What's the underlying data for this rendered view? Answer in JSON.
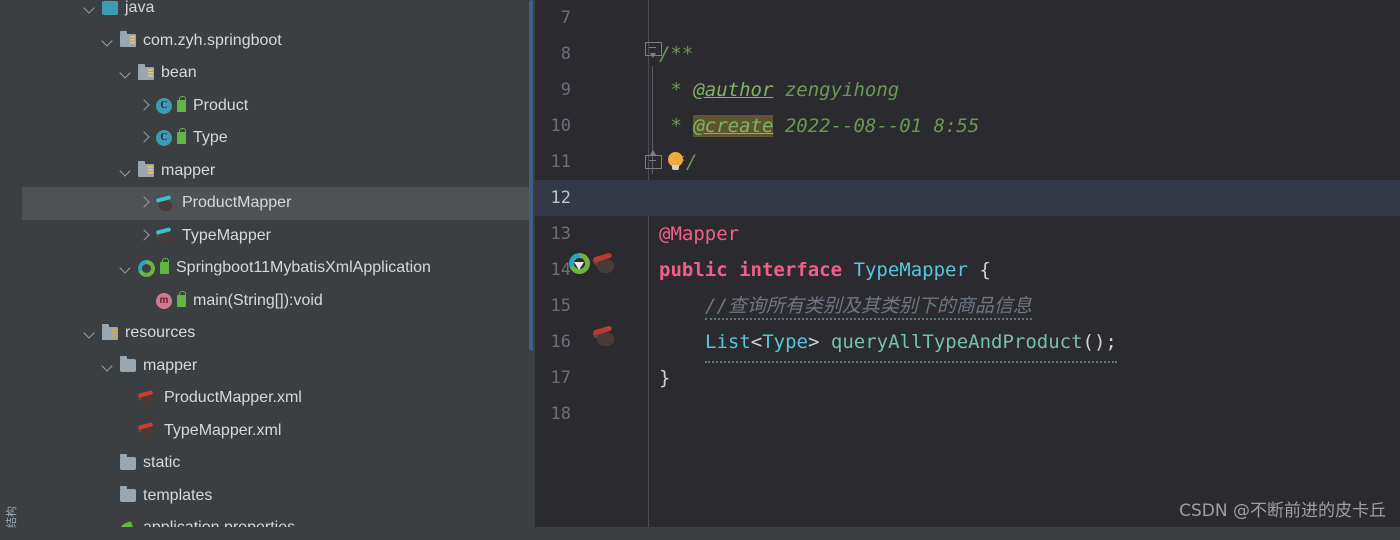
{
  "app": {
    "theme_bg": "#3c3f41",
    "editor_bg": "#2b2b2f",
    "selection_color": "#4e5254",
    "caret_line_color": "#323846",
    "scrollbar_color": "#3d6185"
  },
  "toolwindow": {
    "vertical_tab_label": "结构"
  },
  "project_tree": {
    "items": [
      {
        "label": "java",
        "icon": "java-source-folder-icon",
        "indent": 3,
        "chevron": "down",
        "selected": false,
        "cutoff": true
      },
      {
        "label": "com.zyh.springboot",
        "icon": "package-folder-icon",
        "indent": 4,
        "chevron": "down",
        "selected": false
      },
      {
        "label": "bean",
        "icon": "package-folder-icon",
        "indent": 5,
        "chevron": "down",
        "selected": false
      },
      {
        "label": "Product",
        "icon": "java-class-icon",
        "indent": 6,
        "chevron": "right",
        "selected": false,
        "badge": "public-lock-icon"
      },
      {
        "label": "Type",
        "icon": "java-class-icon",
        "indent": 6,
        "chevron": "right",
        "selected": false,
        "badge": "public-lock-icon"
      },
      {
        "label": "mapper",
        "icon": "package-folder-icon",
        "indent": 5,
        "chevron": "down",
        "selected": false
      },
      {
        "label": "ProductMapper",
        "icon": "mybatis-mapper-icon",
        "indent": 6,
        "chevron": "right",
        "selected": true
      },
      {
        "label": "TypeMapper",
        "icon": "mybatis-mapper-icon",
        "indent": 6,
        "chevron": "right",
        "selected": false
      },
      {
        "label": "Springboot11MybatisXmlApplication",
        "icon": "spring-boot-class-icon",
        "indent": 5,
        "chevron": "down",
        "selected": false,
        "badge": "public-lock-icon"
      },
      {
        "label": "main(String[]):void",
        "icon": "java-method-icon",
        "indent": 6,
        "chevron": "none",
        "selected": false,
        "badge": "public-lock-icon"
      },
      {
        "label": "resources",
        "icon": "resources-folder-icon",
        "indent": 3,
        "chevron": "down",
        "selected": false
      },
      {
        "label": "mapper",
        "icon": "folder-icon",
        "indent": 4,
        "chevron": "down",
        "selected": false
      },
      {
        "label": "ProductMapper.xml",
        "icon": "mybatis-xml-icon",
        "indent": 5,
        "chevron": "none",
        "selected": false
      },
      {
        "label": "TypeMapper.xml",
        "icon": "mybatis-xml-icon",
        "indent": 5,
        "chevron": "none",
        "selected": false
      },
      {
        "label": "static",
        "icon": "folder-icon",
        "indent": 4,
        "chevron": "none",
        "selected": false
      },
      {
        "label": "templates",
        "icon": "folder-icon",
        "indent": 4,
        "chevron": "none",
        "selected": false
      },
      {
        "label": "application.properties",
        "icon": "spring-properties-icon",
        "indent": 4,
        "chevron": "none",
        "selected": false,
        "cutoff": true
      }
    ]
  },
  "editor": {
    "filename": "TypeMapper",
    "caret_line": 12,
    "lines": [
      {
        "num": "7",
        "text": ""
      },
      {
        "num": "8",
        "text": "/**"
      },
      {
        "num": "9",
        "text": " * @author zengyihong"
      },
      {
        "num": "10",
        "text": " * @create 2022--08--01 8:55"
      },
      {
        "num": "11",
        "text": " */"
      },
      {
        "num": "12",
        "text": ""
      },
      {
        "num": "13",
        "text": "@Mapper"
      },
      {
        "num": "14",
        "text": "public interface TypeMapper {"
      },
      {
        "num": "15",
        "text": "    //查询所有类别及其类别下的商品信息"
      },
      {
        "num": "16",
        "text": "    List<Type> queryAllTypeAndProduct();"
      },
      {
        "num": "17",
        "text": "}"
      },
      {
        "num": "18",
        "text": ""
      }
    ],
    "tokens": {
      "doc_open": "/**",
      "doc_star": " * ",
      "tag_author": "@author",
      "author_value": " zengyihong",
      "tag_create": "@create",
      "create_value": " 2022--08--01 8:55",
      "doc_close": " */",
      "annotation_mapper": "@Mapper",
      "kw_public": "public",
      "kw_interface": "interface",
      "type_name": "TypeMapper",
      "brace_open": " {",
      "comment_cn": "//查询所有类别及其类别下的商品信息",
      "type_list": "List",
      "generic_open": "<",
      "type_generic": "Type",
      "generic_close": "> ",
      "method_name": "queryAllTypeAndProduct",
      "call_end": "();",
      "brace_close": "}"
    },
    "gutter_icons": [
      {
        "line": "14",
        "name": "spring-bean-gutter-icon"
      },
      {
        "line": "14",
        "name": "mybatis-navigate-gutter-icon"
      },
      {
        "line": "16",
        "name": "mybatis-navigate-gutter-icon"
      }
    ],
    "fold_markers": [
      {
        "line": "8",
        "name": "fold-region-start-icon"
      },
      {
        "line": "11",
        "name": "fold-region-end-icon"
      }
    ],
    "intention_bulb": {
      "line": "11",
      "name": "intention-bulb-icon"
    }
  },
  "watermark": {
    "text": "CSDN @不断前进的皮卡丘"
  }
}
